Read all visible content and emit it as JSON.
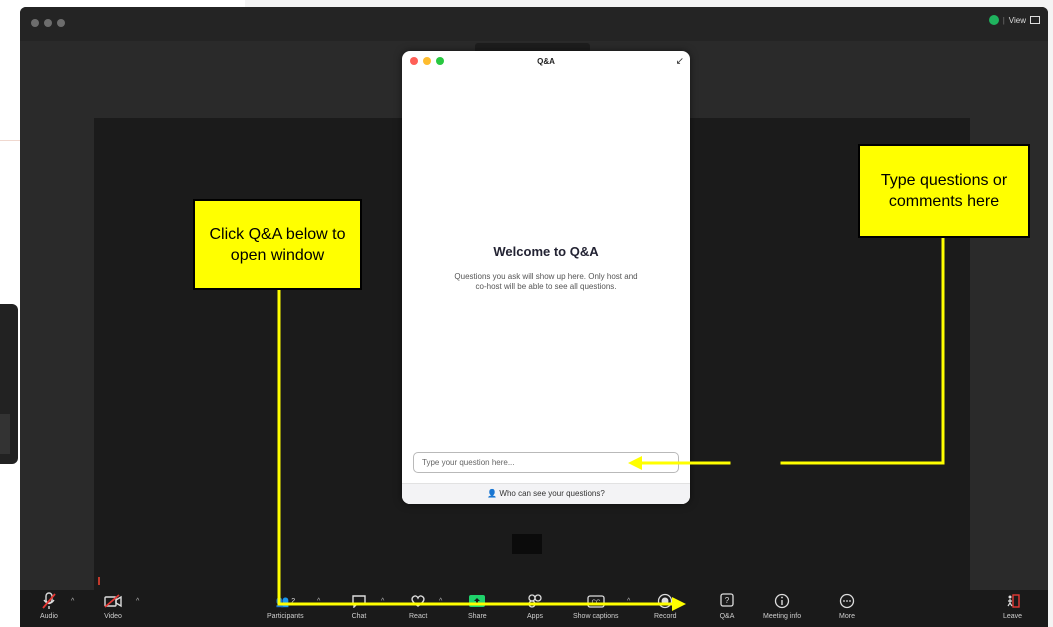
{
  "qa_window": {
    "title": "Q&A",
    "welcome_heading": "Welcome to Q&A",
    "description": "Questions you ask will show up here. Only host and co-host will be able to see all questions.",
    "input_placeholder": "Type your question here...",
    "footer_text": "Who can see your questions?"
  },
  "header": {
    "view_label": "View"
  },
  "toolbar": {
    "audio": "Audio",
    "video": "Video",
    "participants": "Participants",
    "participants_count": "2",
    "chat": "Chat",
    "react": "React",
    "share": "Share",
    "apps": "Apps",
    "show_captions": "Show captions",
    "record": "Record",
    "qa": "Q&A",
    "meeting_info": "Meeting info",
    "more": "More",
    "leave": "Leave"
  },
  "callouts": {
    "click_qa": "Click Q&A below to open window",
    "type_questions": "Type questions or comments here"
  },
  "colors": {
    "callout_fill": "#ffff00",
    "arrow": "#ffff00",
    "share_green": "#1fd26b",
    "security_green": "#1fb35e"
  }
}
